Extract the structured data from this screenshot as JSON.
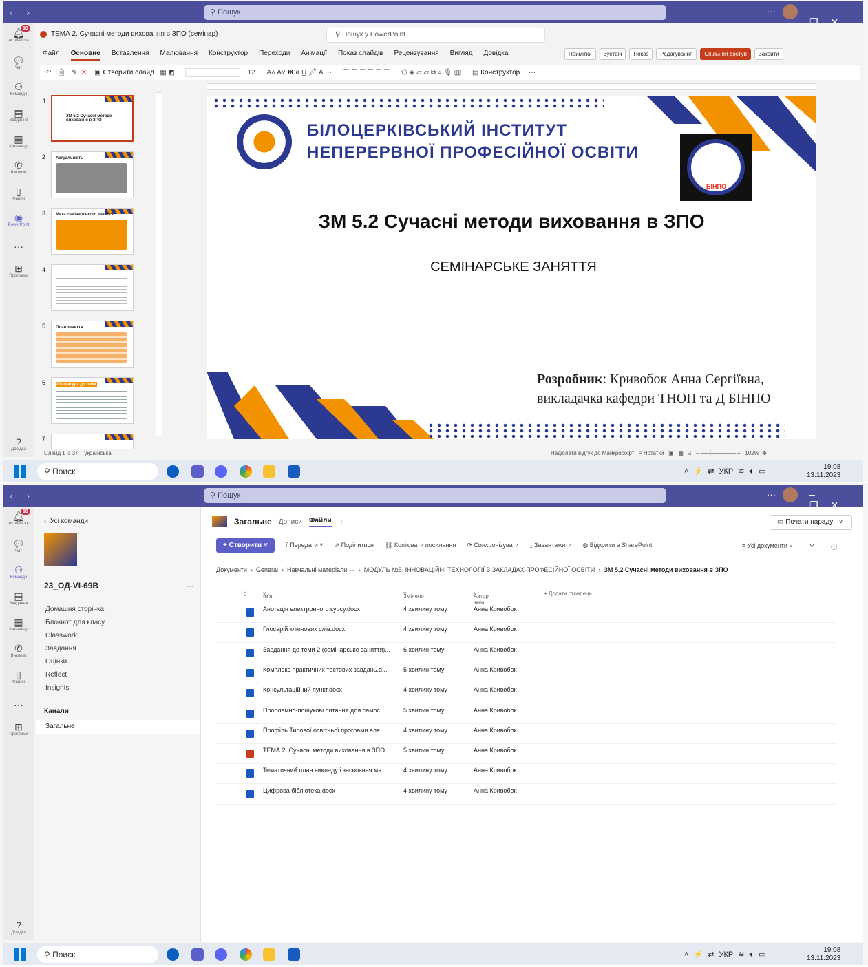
{
  "common": {
    "search": "Пошук",
    "rail": [
      {
        "label": "Активність",
        "icon": "bell-icon",
        "badge": "10"
      },
      {
        "label": "Чат",
        "icon": "chat-icon"
      },
      {
        "label": "Команди",
        "icon": "teams-icon"
      },
      {
        "label": "Завдання",
        "icon": "assignments-icon"
      },
      {
        "label": "Календар",
        "icon": "calendar-icon"
      },
      {
        "label": "Виклики",
        "icon": "calls-icon"
      },
      {
        "label": "Файли",
        "icon": "files-icon"
      },
      {
        "label": "PowerPoint",
        "icon": "powerpoint-icon"
      },
      {
        "label": "Програми",
        "icon": "apps-icon"
      },
      {
        "label": "Довідка",
        "icon": "help-icon"
      }
    ],
    "taskbar": {
      "search": "Поиск",
      "lang": "УКР",
      "time": "19:08",
      "date": "13.11.2023"
    }
  },
  "ppt": {
    "doc_title": "ТЕМА 2. Сучасні методи виховання в ЗПО (семінар)",
    "search_placeholder": "Пошук у PowerPoint",
    "tabs": [
      "Файл",
      "Основне",
      "Вставлення",
      "Малювання",
      "Конструктор",
      "Переходи",
      "Анімації",
      "Показ слайдів",
      "Рецензування",
      "Вигляд",
      "Довідка"
    ],
    "right_buttons": {
      "notes": "Примітки",
      "meet": "Зустріч",
      "show": "Показ",
      "edit": "Редагування",
      "share": "Спільний доступ",
      "close": "Закрити"
    },
    "ribbon": {
      "new_slide": "Створити слайд",
      "font_size": "12",
      "designer": "Конструктор"
    },
    "thumbnails": [
      {
        "num": "1",
        "title": "ЗМ 5.2 Сучасні методи виховання в ЗПО"
      },
      {
        "num": "2",
        "title": "Актуальність"
      },
      {
        "num": "3",
        "title": "Мета семінарського заняття"
      },
      {
        "num": "4",
        "title": ""
      },
      {
        "num": "5",
        "title": "План заняття"
      },
      {
        "num": "6",
        "title": "Література до теми"
      },
      {
        "num": "7",
        "title": ""
      }
    ],
    "slide": {
      "inst1": "БІЛОЦЕРКІВСЬКИЙ ІНСТИТУТ",
      "inst2": "НЕПЕРЕРВНОЇ ПРОФЕСІЙНОЇ ОСВІТИ",
      "title": "ЗМ 5.2 Сучасні методи виховання в ЗПО",
      "subtitle": "СЕМІНАРСЬКЕ ЗАНЯТТЯ",
      "author_label": "Розробник",
      "author_name": ": Кривобок Анна Сергіївна,",
      "author_line2": "викладачка кафедри ТНОП та Д БІНПО",
      "logo_text": "БІНПО"
    },
    "status": {
      "slide": "Слайд 1 із 37",
      "lang": "українська",
      "feedback": "Надіслати відгук до Майкрософт",
      "notes": "Нотатки",
      "zoom": "102%"
    }
  },
  "teams": {
    "back": "Усі команди",
    "team_name": "23_ОД-VI-69В",
    "nav": [
      "Домашня сторінка",
      "Блокнот для класу",
      "Classwork",
      "Завдання",
      "Оцінки",
      "Reflect",
      "Insights"
    ],
    "channels_header": "Канали",
    "channel": "Загальне",
    "header": {
      "channel": "Загальне",
      "posts": "Дописи",
      "files": "Файли"
    },
    "meet_button": "Почати нараду",
    "commands": {
      "create": "Створити",
      "upload": "Передати",
      "share": "Поділитися",
      "copy_link": "Копіювати посилання",
      "sync": "Синхронізувати",
      "download": "Завантажити",
      "sharepoint": "Відкрити в SharePoint",
      "all_docs": "Усі документи"
    },
    "breadcrumb": [
      "Документи",
      "General",
      "Навчальні матеріали",
      "МОДУЛЬ №5. ІННОВАЦІЙНІ ТЕХНОЛОГІЇ В ЗАКЛАДАХ ПРОФЕСІЙНОЇ ОСВІТИ",
      "ЗМ 5.2 Сучасні методи виховання в ЗПО"
    ],
    "columns": {
      "name": "Ім'я",
      "modified": "Змінено",
      "author": "Автор змін",
      "add": "+ Додати стовпець"
    },
    "files": [
      {
        "name": "Анотація електронного курсу.docx",
        "modified": "4 хвилину тому",
        "author": "Анна Кривобок",
        "type": "word"
      },
      {
        "name": "Глосарій ключових слів.docx",
        "modified": "4 хвилину тому",
        "author": "Анна Кривобок",
        "type": "word"
      },
      {
        "name": "Завдання до теми 2 (семінарське заняття)...",
        "modified": "6 хвилин тому",
        "author": "Анна Кривобок",
        "type": "word"
      },
      {
        "name": "Комплекс практичних тестових завдань.d...",
        "modified": "5 хвилин тому",
        "author": "Анна Кривобок",
        "type": "word"
      },
      {
        "name": "Консультаційний пункт.docx",
        "modified": "4 хвилину тому",
        "author": "Анна Кривобок",
        "type": "word"
      },
      {
        "name": "Проблемно-пошукові питання для самос...",
        "modified": "5 хвилин тому",
        "author": "Анна Кривобок",
        "type": "word"
      },
      {
        "name": "Профіль Типової освітньої програми еле...",
        "modified": "4 хвилину тому",
        "author": "Анна Кривобок",
        "type": "word"
      },
      {
        "name": "ТЕМА 2. Сучасні методи виховання в ЗПО...",
        "modified": "5 хвилин тому",
        "author": "Анна Кривобок",
        "type": "ppt"
      },
      {
        "name": "Тематичний план викладу і засвоєння ма...",
        "modified": "4 хвилину тому",
        "author": "Анна Кривобок",
        "type": "word"
      },
      {
        "name": "Цифрова бібліотека.docx",
        "modified": "4 хвилину тому",
        "author": "Анна Кривобок",
        "type": "word"
      }
    ]
  }
}
